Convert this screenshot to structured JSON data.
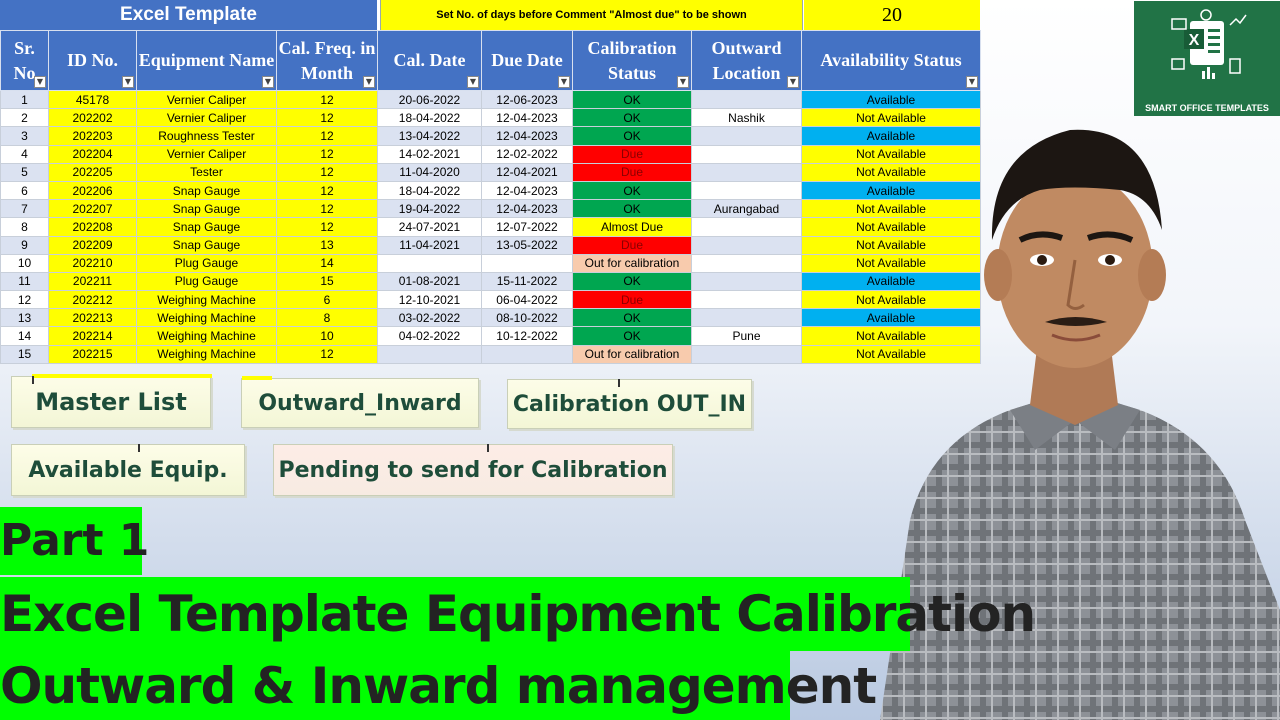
{
  "sheet": {
    "title": "Excel Template",
    "setting_label": "Set No. of days before Comment \"Almost due\" to be shown",
    "setting_value": "20",
    "headers": [
      "Sr. No",
      "ID No.",
      "Equipment Name",
      "Cal. Freq. in Month",
      "Cal. Date",
      "Due Date",
      "Calibration Status",
      "Outward Location",
      "Availability Status"
    ],
    "filter_icon": "dropdown-arrow-icon",
    "rows": [
      {
        "sr": "1",
        "id": "45178",
        "name": "Vernier Caliper",
        "freq": "12",
        "cal": "20-06-2022",
        "due": "12-06-2023",
        "status": "OK",
        "loc": "",
        "avail": "Available"
      },
      {
        "sr": "2",
        "id": "202202",
        "name": "Vernier Caliper",
        "freq": "12",
        "cal": "18-04-2022",
        "due": "12-04-2023",
        "status": "OK",
        "loc": "Nashik",
        "avail": "Not Available"
      },
      {
        "sr": "3",
        "id": "202203",
        "name": "Roughness Tester",
        "freq": "12",
        "cal": "13-04-2022",
        "due": "12-04-2023",
        "status": "OK",
        "loc": "",
        "avail": "Available"
      },
      {
        "sr": "4",
        "id": "202204",
        "name": "Vernier Caliper",
        "freq": "12",
        "cal": "14-02-2021",
        "due": "12-02-2022",
        "status": "Due",
        "loc": "",
        "avail": "Not Available"
      },
      {
        "sr": "5",
        "id": "202205",
        "name": "Tester",
        "freq": "12",
        "cal": "11-04-2020",
        "due": "12-04-2021",
        "status": "Due",
        "loc": "",
        "avail": "Not Available"
      },
      {
        "sr": "6",
        "id": "202206",
        "name": "Snap Gauge",
        "freq": "12",
        "cal": "18-04-2022",
        "due": "12-04-2023",
        "status": "OK",
        "loc": "",
        "avail": "Available"
      },
      {
        "sr": "7",
        "id": "202207",
        "name": "Snap Gauge",
        "freq": "12",
        "cal": "19-04-2022",
        "due": "12-04-2023",
        "status": "OK",
        "loc": "Aurangabad",
        "avail": "Not Available"
      },
      {
        "sr": "8",
        "id": "202208",
        "name": "Snap Gauge",
        "freq": "12",
        "cal": "24-07-2021",
        "due": "12-07-2022",
        "status": "Almost Due",
        "loc": "",
        "avail": "Not Available"
      },
      {
        "sr": "9",
        "id": "202209",
        "name": "Snap Gauge",
        "freq": "13",
        "cal": "11-04-2021",
        "due": "13-05-2022",
        "status": "Due",
        "loc": "",
        "avail": "Not Available"
      },
      {
        "sr": "10",
        "id": "202210",
        "name": "Plug Gauge",
        "freq": "14",
        "cal": "",
        "due": "",
        "status": "Out for calibration",
        "loc": "",
        "avail": "Not Available"
      },
      {
        "sr": "11",
        "id": "202211",
        "name": "Plug Gauge",
        "freq": "15",
        "cal": "01-08-2021",
        "due": "15-11-2022",
        "status": "OK",
        "loc": "",
        "avail": "Available"
      },
      {
        "sr": "12",
        "id": "202212",
        "name": "Weighing Machine",
        "freq": "6",
        "cal": "12-10-2021",
        "due": "06-04-2022",
        "status": "Due",
        "loc": "",
        "avail": "Not Available"
      },
      {
        "sr": "13",
        "id": "202213",
        "name": "Weighing Machine",
        "freq": "8",
        "cal": "03-02-2022",
        "due": "08-10-2022",
        "status": "OK",
        "loc": "",
        "avail": "Available"
      },
      {
        "sr": "14",
        "id": "202214",
        "name": "Weighing Machine",
        "freq": "10",
        "cal": "04-02-2022",
        "due": "10-12-2022",
        "status": "OK",
        "loc": "Pune",
        "avail": "Not Available"
      },
      {
        "sr": "15",
        "id": "202215",
        "name": "Weighing Machine",
        "freq": "12",
        "cal": "",
        "due": "",
        "status": "Out for calibration",
        "loc": "",
        "avail": "Not Available"
      }
    ],
    "status_colors": {
      "OK": "#00a650",
      "Due": "#ff0000",
      "Almost Due": "#ffff00",
      "Out for calibration": "#f8cbad"
    },
    "availability_colors": {
      "Available": "#00b0f0",
      "Not Available": "#ffff00"
    }
  },
  "buttons": {
    "master_list": "Master List",
    "outward_inward": "Outward_Inward",
    "calibration_out_in": "Calibration OUT_IN",
    "available_equip": "Available Equip.",
    "pending_calibration": "Pending to send for Calibration"
  },
  "thumbnail_title": {
    "part": "Part 1",
    "line1": "Excel Template Equipment Calibration",
    "line2": "Outward & Inward management",
    "band_color": "#00ff00"
  },
  "logo": {
    "label": "SMART OFFICE TEMPLATES",
    "icon": "excel-icon",
    "letter": "X",
    "color": "#217346"
  },
  "presenter": {
    "icon": "presenter-photo"
  }
}
